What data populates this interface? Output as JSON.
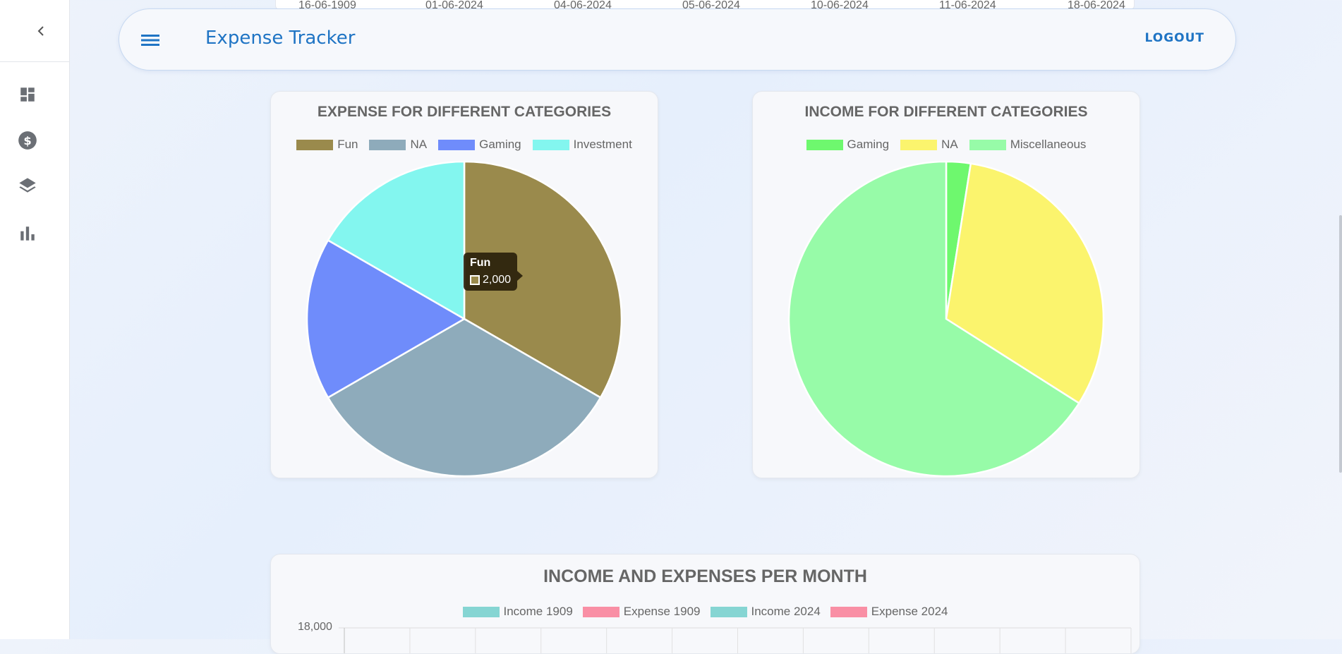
{
  "app": {
    "title": "Expense Tracker",
    "logout_label": "LOGOUT"
  },
  "sidebar": {
    "items": [
      {
        "icon": "dashboard-icon"
      },
      {
        "icon": "dollar-icon"
      },
      {
        "icon": "layers-icon"
      },
      {
        "icon": "bar-chart-icon"
      }
    ]
  },
  "top_strip": {
    "dates": [
      "16-06-1909",
      "01-06-2024",
      "04-06-2024",
      "05-06-2024",
      "10-06-2024",
      "11-06-2024",
      "18-06-2024"
    ]
  },
  "expense_card": {
    "title": "EXPENSE FOR DIFFERENT CATEGORIES"
  },
  "income_card": {
    "title": "INCOME FOR DIFFERENT CATEGORIES"
  },
  "monthly_card": {
    "title": "INCOME AND EXPENSES PER MONTH",
    "y_top_tick": "18,000"
  },
  "tooltip": {
    "title": "Fun",
    "value": "2,000",
    "color": "#9a8a4c"
  },
  "chart_data": [
    {
      "type": "pie",
      "title": "EXPENSE FOR DIFFERENT CATEGORIES",
      "legend": "top",
      "categories": [
        "Fun",
        "NA",
        "Gaming",
        "Investment"
      ],
      "values": [
        2000,
        2000,
        1000,
        1000
      ],
      "colors": [
        "#9a8a4c",
        "#8eabbb",
        "#6f8cfb",
        "#83f6ef"
      ]
    },
    {
      "type": "pie",
      "title": "INCOME FOR DIFFERENT CATEGORIES",
      "legend": "top",
      "categories": [
        "Gaming",
        "NA",
        "Miscellaneous"
      ],
      "values": [
        2.5,
        31.5,
        66
      ],
      "colors": [
        "#6ef86e",
        "#fbf46d",
        "#97fba8"
      ]
    },
    {
      "type": "bar",
      "title": "INCOME AND EXPENSES PER MONTH",
      "legend": "top",
      "series": [
        {
          "name": "Income 1909",
          "color": "#86d5d3"
        },
        {
          "name": "Expense 1909",
          "color": "#f98fa5"
        },
        {
          "name": "Income 2024",
          "color": "#86d5d3"
        },
        {
          "name": "Expense 2024",
          "color": "#f98fa5"
        }
      ],
      "y_ticks": [
        18000
      ],
      "grid": true
    }
  ]
}
